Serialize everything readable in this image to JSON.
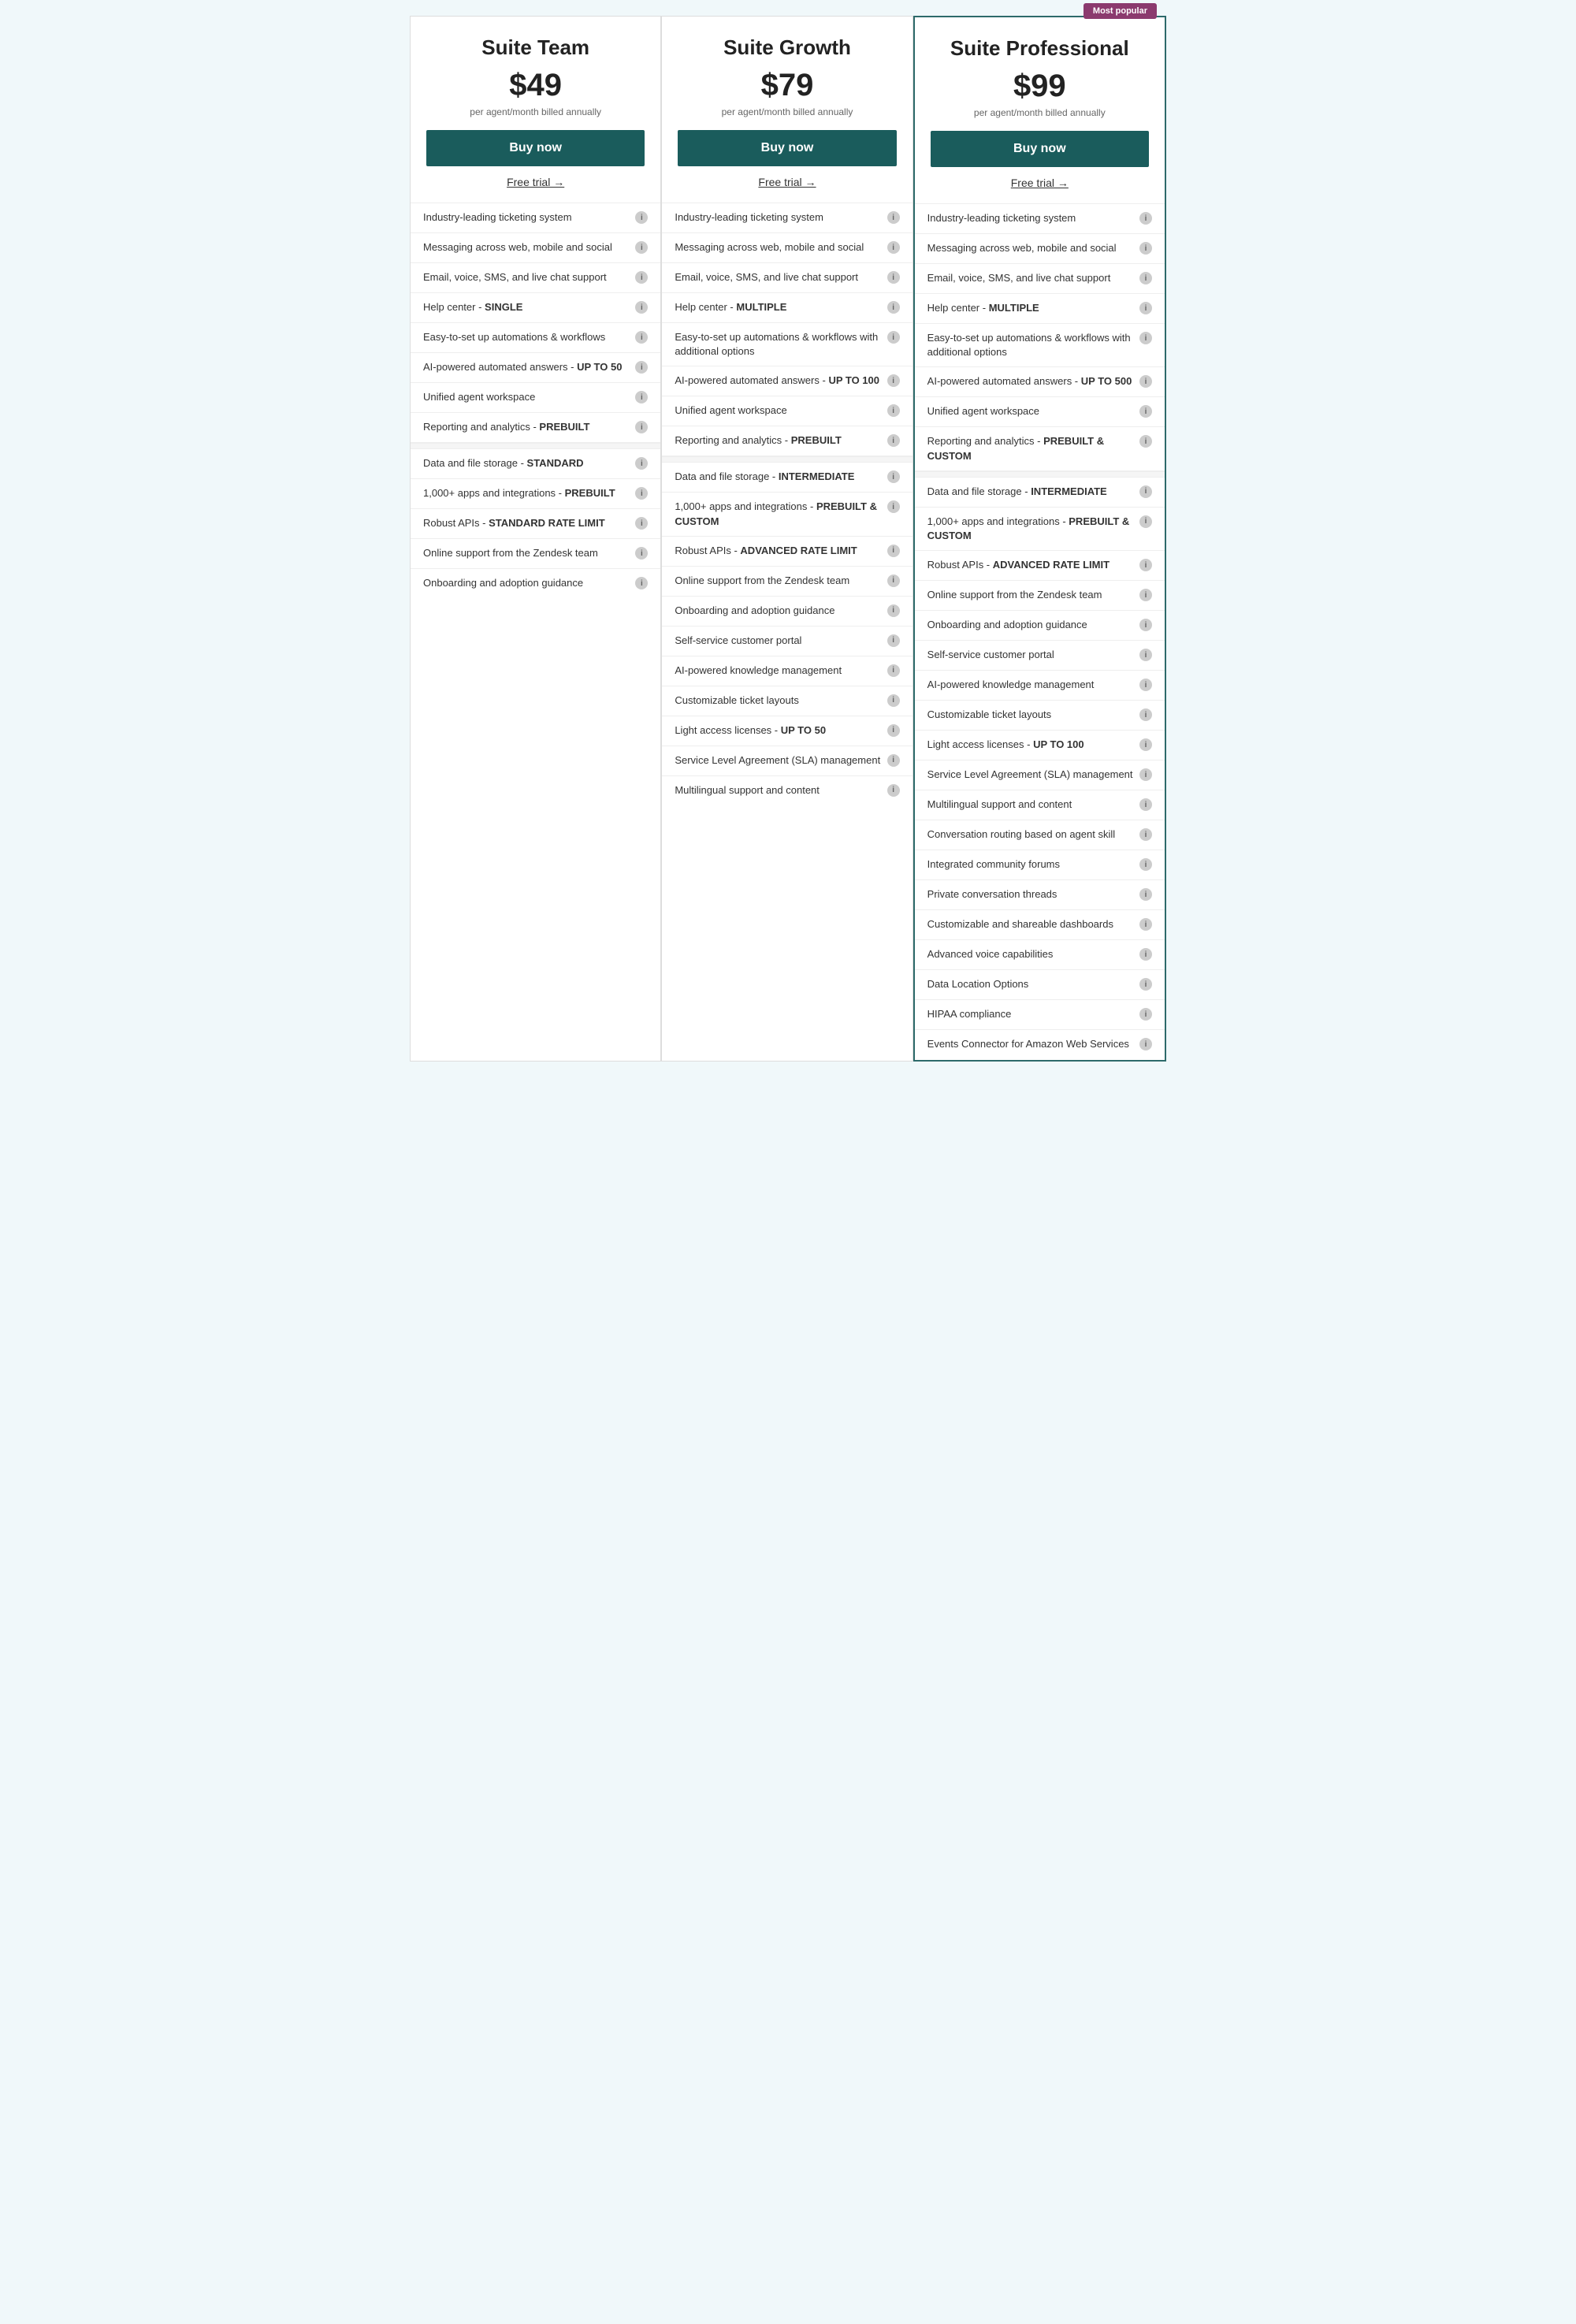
{
  "plans": [
    {
      "id": "suite-team",
      "name": "Suite Team",
      "price": "$49",
      "billing": "per agent/month billed annually",
      "buy_label": "Buy now",
      "free_trial": "Free trial →",
      "popular": false,
      "features": [
        {
          "text": "Industry-leading ticketing system",
          "bold_part": null
        },
        {
          "text": "Messaging across web, mobile and social",
          "bold_part": null
        },
        {
          "text": "Email, voice, SMS, and live chat support",
          "bold_part": null
        },
        {
          "text": "Help center - SINGLE",
          "bold_part": "SINGLE"
        },
        {
          "text": "Easy-to-set up automations & workflows",
          "bold_part": null
        },
        {
          "text": "AI-powered automated answers - UP TO 50",
          "bold_part": "UP TO 50"
        },
        {
          "text": "Unified agent workspace",
          "bold_part": null
        },
        {
          "text": "Reporting and analytics - PREBUILT",
          "bold_part": "PREBUILT"
        },
        "DIVIDER",
        {
          "text": "Data and file storage - STANDARD",
          "bold_part": "STANDARD"
        },
        {
          "text": "1,000+ apps and integrations - PREBUILT",
          "bold_part": "PREBUILT"
        },
        {
          "text": "Robust APIs - STANDARD RATE LIMIT",
          "bold_part": "STANDARD RATE LIMIT"
        },
        {
          "text": "Online support from the Zendesk team",
          "bold_part": null
        },
        {
          "text": "Onboarding and adoption guidance",
          "bold_part": null
        }
      ]
    },
    {
      "id": "suite-growth",
      "name": "Suite Growth",
      "price": "$79",
      "billing": "per agent/month billed annually",
      "buy_label": "Buy now",
      "free_trial": "Free trial →",
      "popular": false,
      "features": [
        {
          "text": "Industry-leading ticketing system",
          "bold_part": null
        },
        {
          "text": "Messaging across web, mobile and social",
          "bold_part": null
        },
        {
          "text": "Email, voice, SMS, and live chat support",
          "bold_part": null
        },
        {
          "text": "Help center - MULTIPLE",
          "bold_part": "MULTIPLE"
        },
        {
          "text": "Easy-to-set up automations & workflows with additional options",
          "bold_part": null
        },
        {
          "text": "AI-powered automated answers - UP TO 100",
          "bold_part": "UP TO 100"
        },
        {
          "text": "Unified agent workspace",
          "bold_part": null
        },
        {
          "text": "Reporting and analytics - PREBUILT",
          "bold_part": "PREBUILT"
        },
        "DIVIDER",
        {
          "text": "Data and file storage - INTERMEDIATE",
          "bold_part": "INTERMEDIATE"
        },
        {
          "text": "1,000+ apps and integrations - PREBUILT & CUSTOM",
          "bold_part": "PREBUILT & CUSTOM"
        },
        {
          "text": "Robust APIs - ADVANCED RATE LIMIT",
          "bold_part": "ADVANCED RATE LIMIT"
        },
        {
          "text": "Online support from the Zendesk team",
          "bold_part": null
        },
        {
          "text": "Onboarding and adoption guidance",
          "bold_part": null
        },
        {
          "text": "Self-service customer portal",
          "bold_part": null
        },
        {
          "text": "AI-powered knowledge management",
          "bold_part": null
        },
        {
          "text": "Customizable ticket layouts",
          "bold_part": null
        },
        {
          "text": "Light access licenses - UP TO 50",
          "bold_part": "UP TO 50"
        },
        {
          "text": "Service Level Agreement (SLA) management",
          "bold_part": null
        },
        {
          "text": "Multilingual support and content",
          "bold_part": null
        }
      ]
    },
    {
      "id": "suite-professional",
      "name": "Suite Professional",
      "price": "$99",
      "billing": "per agent/month billed annually",
      "buy_label": "Buy now",
      "free_trial": "Free trial →",
      "popular": true,
      "popular_label": "Most popular",
      "features": [
        {
          "text": "Industry-leading ticketing system",
          "bold_part": null
        },
        {
          "text": "Messaging across web, mobile and social",
          "bold_part": null
        },
        {
          "text": "Email, voice, SMS, and live chat support",
          "bold_part": null
        },
        {
          "text": "Help center - MULTIPLE",
          "bold_part": "MULTIPLE"
        },
        {
          "text": "Easy-to-set up automations & workflows with additional options",
          "bold_part": null
        },
        {
          "text": "AI-powered automated answers - UP TO 500",
          "bold_part": "UP TO 500"
        },
        {
          "text": "Unified agent workspace",
          "bold_part": null
        },
        {
          "text": "Reporting and analytics - PREBUILT & CUSTOM",
          "bold_part": "PREBUILT & CUSTOM"
        },
        "DIVIDER",
        {
          "text": "Data and file storage - INTERMEDIATE",
          "bold_part": "INTERMEDIATE"
        },
        {
          "text": "1,000+ apps and integrations - PREBUILT & CUSTOM",
          "bold_part": "PREBUILT & CUSTOM"
        },
        {
          "text": "Robust APIs - ADVANCED RATE LIMIT",
          "bold_part": "ADVANCED RATE LIMIT"
        },
        {
          "text": "Online support from the Zendesk team",
          "bold_part": null
        },
        {
          "text": "Onboarding and adoption guidance",
          "bold_part": null
        },
        {
          "text": "Self-service customer portal",
          "bold_part": null
        },
        {
          "text": "AI-powered knowledge management",
          "bold_part": null
        },
        {
          "text": "Customizable ticket layouts",
          "bold_part": null
        },
        {
          "text": "Light access licenses - UP TO 100",
          "bold_part": "UP TO 100"
        },
        {
          "text": "Service Level Agreement (SLA) management",
          "bold_part": null
        },
        {
          "text": "Multilingual support and content",
          "bold_part": null
        },
        {
          "text": "Conversation routing based on agent skill",
          "bold_part": null
        },
        {
          "text": "Integrated community forums",
          "bold_part": null
        },
        {
          "text": "Private conversation threads",
          "bold_part": null
        },
        {
          "text": "Customizable and shareable dashboards",
          "bold_part": null
        },
        {
          "text": "Advanced voice capabilities",
          "bold_part": null
        },
        {
          "text": "Data Location Options",
          "bold_part": null
        },
        {
          "text": "HIPAA compliance",
          "bold_part": null
        },
        {
          "text": "Events Connector for Amazon Web Services",
          "bold_part": null
        }
      ]
    }
  ]
}
